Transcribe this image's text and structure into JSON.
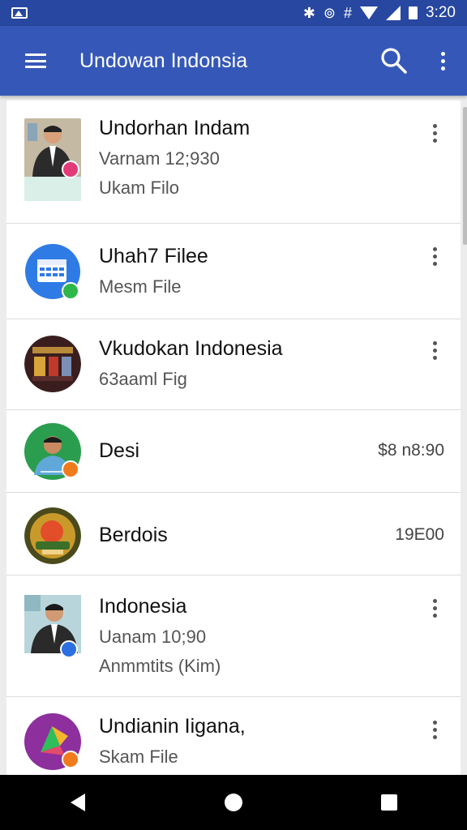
{
  "status_bar": {
    "time": "3:20",
    "icons": [
      "photo-icon",
      "bluetooth-icon",
      "nfc-icon",
      "vibrate-icon",
      "wifi-icon",
      "signal-icon",
      "battery-icon"
    ],
    "bluetooth_glyph": "✱",
    "nfc_glyph": "⊚",
    "vibrate_glyph": "#"
  },
  "app_bar": {
    "title": "Undowan Indonsia",
    "icons": [
      "menu-icon",
      "search-icon",
      "more-vert-icon"
    ]
  },
  "colors": {
    "status_bar": "#2747a0",
    "app_bar": "#3558b8",
    "badge_pink": "#e33b78",
    "badge_green": "#2eb84a",
    "badge_orange": "#f07b1d",
    "badge_blue": "#2c6fe0",
    "calendar_blue": "#2f7be6"
  },
  "files": [
    {
      "title": "Undorhan Indam",
      "subtitle": "Varnam 12;930",
      "detail": "Ukam Filo",
      "icon": "person-photo-icon",
      "has_menu": true
    },
    {
      "title": "Uhah7 Filee",
      "subtitle": "Mesm File",
      "icon": "calendar-icon",
      "has_menu": true
    },
    {
      "title": "Vkudokan Indonesia",
      "subtitle": "63aaml Fig",
      "icon": "store-photo-icon",
      "has_menu": true
    },
    {
      "title": "Desi",
      "trailing": "$8 n8:90",
      "icon": "person-photo-icon",
      "has_menu": false
    },
    {
      "title": "Berdois",
      "trailing": "19E00",
      "icon": "food-photo-icon",
      "has_menu": false
    },
    {
      "title": "Indonesia",
      "subtitle": "Uanam 10;90",
      "detail": "Anmmtits (Kim)",
      "icon": "person-photo-icon",
      "has_menu": true
    },
    {
      "title": "Undianin Iigana,",
      "subtitle": "Skam File",
      "icon": "app-logo-icon",
      "has_menu": true
    }
  ],
  "nav_bar": {
    "buttons": [
      "back-icon",
      "home-icon",
      "recents-icon"
    ]
  }
}
